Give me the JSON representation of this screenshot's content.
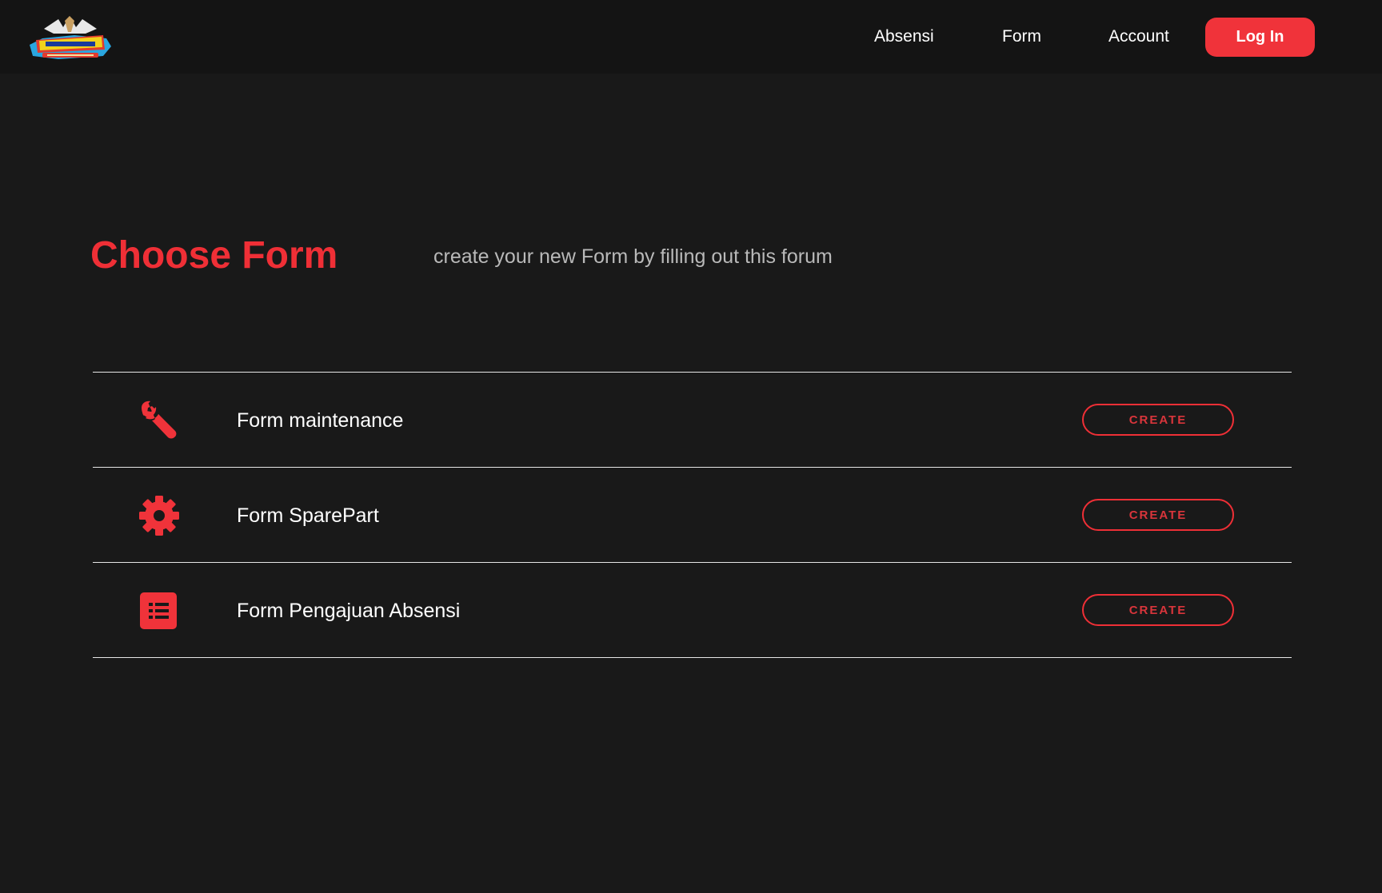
{
  "nav": {
    "links": [
      {
        "label": "Absensi"
      },
      {
        "label": "Form"
      },
      {
        "label": "Account"
      }
    ],
    "login_label": "Log In"
  },
  "header": {
    "title": "Choose Form",
    "subtitle": "create your new Form by filling out this forum"
  },
  "forms": [
    {
      "label": "Form maintenance",
      "icon": "wrench-icon",
      "button": "CREATE"
    },
    {
      "label": "Form SparePart",
      "icon": "gear-icon",
      "button": "CREATE"
    },
    {
      "label": "Form Pengajuan Absensi",
      "icon": "list-icon",
      "button": "CREATE"
    }
  ],
  "colors": {
    "background": "#191919",
    "navbar": "#141414",
    "accent": "#ef2f36",
    "subtitle": "#b9b9b9"
  }
}
